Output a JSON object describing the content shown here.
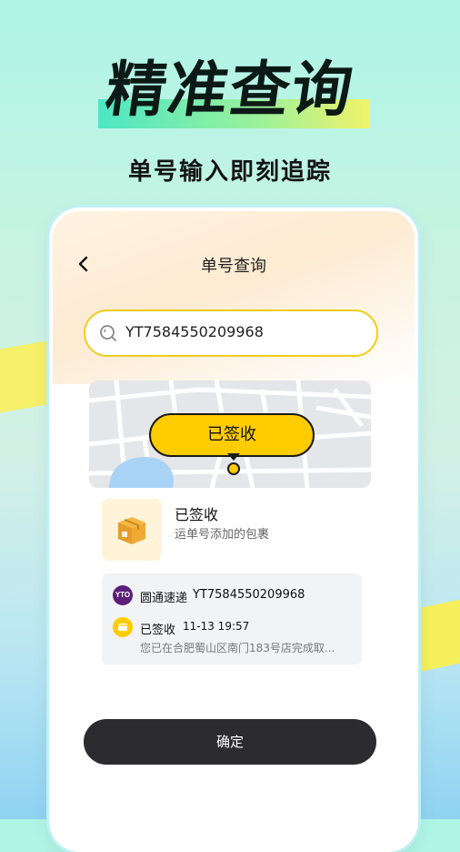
{
  "hero": {
    "title": "精准查询",
    "subtitle": "单号输入即刻追踪"
  },
  "nav": {
    "back_icon": "chevron-left-icon",
    "title": "单号查询"
  },
  "search": {
    "icon": "search-icon",
    "value": "YT7584550209968"
  },
  "map": {
    "badge_label": "已签收"
  },
  "package": {
    "icon": "package-box-icon",
    "status_title": "已签收",
    "status_subtitle": "运单号添加的包裹"
  },
  "tracking": {
    "courier_logo_text": "YTO",
    "courier_name": "圆通速递",
    "tracking_number": "YT7584550209968",
    "status_icon": "delivered-box-icon",
    "status_label": "已签收",
    "status_time": "11-13 19:57",
    "status_description": "您已在合肥蜀山区南门183号店完成取..."
  },
  "actions": {
    "confirm_label": "确定"
  },
  "colors": {
    "accent_yellow": "#ffcc00",
    "button_dark": "#2c2c2e",
    "courier_purple": "#5b1f7a"
  }
}
